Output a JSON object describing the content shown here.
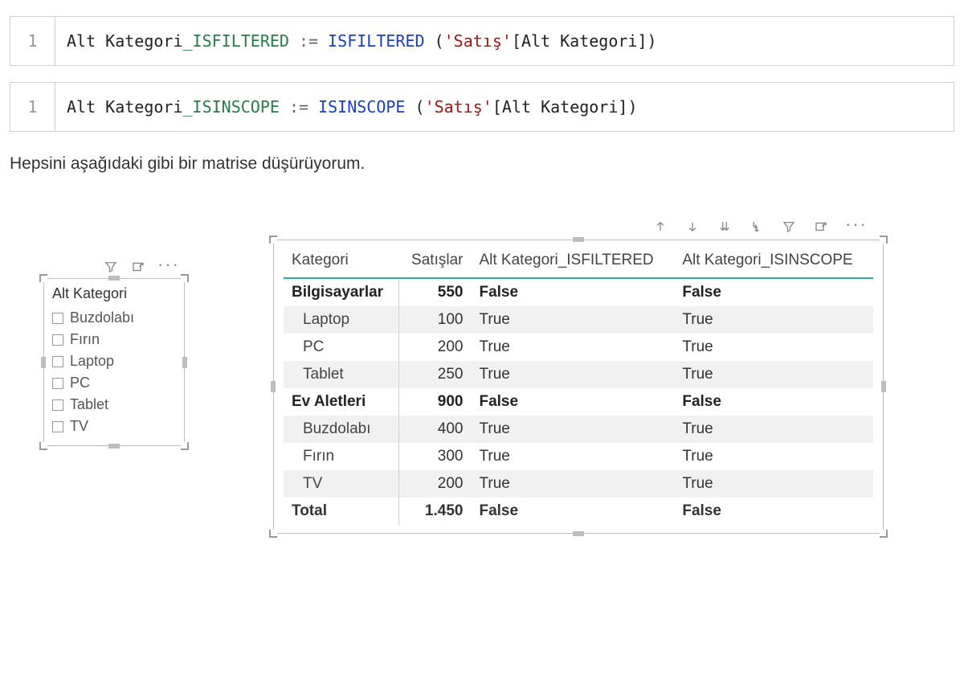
{
  "code_blocks": [
    {
      "line_no": "1",
      "measure_name": "Alt Kategori",
      "suffix": "_ISFILTERED",
      "assign": " := ",
      "func": "ISFILTERED",
      "open": " (",
      "string": "'Satış'",
      "column": "[Alt Kategori]",
      "close": ")"
    },
    {
      "line_no": "1",
      "measure_name": "Alt Kategori",
      "suffix": "_ISINSCOPE",
      "assign": " := ",
      "func": "ISINSCOPE",
      "open": " (",
      "string": "'Satış'",
      "column": "[Alt Kategori]",
      "close": ")"
    }
  ],
  "prose_text": "Hepsini aşağıdaki gibi bir matrise düşürüyorum.",
  "slicer": {
    "title": "Alt Kategori",
    "items": [
      "Buzdolabı",
      "Fırın",
      "Laptop",
      "PC",
      "Tablet",
      "TV"
    ]
  },
  "matrix": {
    "headers": [
      "Kategori",
      "Satışlar",
      "Alt Kategori_ISFILTERED",
      "Alt Kategori_ISINSCOPE"
    ],
    "rows": [
      {
        "level": 0,
        "label": "Bilgisayarlar",
        "sales": "550",
        "isfiltered": "False",
        "isinscope": "False",
        "striped": false
      },
      {
        "level": 1,
        "label": "Laptop",
        "sales": "100",
        "isfiltered": "True",
        "isinscope": "True",
        "striped": true
      },
      {
        "level": 1,
        "label": "PC",
        "sales": "200",
        "isfiltered": "True",
        "isinscope": "True",
        "striped": false
      },
      {
        "level": 1,
        "label": "Tablet",
        "sales": "250",
        "isfiltered": "True",
        "isinscope": "True",
        "striped": true
      },
      {
        "level": 0,
        "label": "Ev Aletleri",
        "sales": "900",
        "isfiltered": "False",
        "isinscope": "False",
        "striped": false
      },
      {
        "level": 1,
        "label": "Buzdolabı",
        "sales": "400",
        "isfiltered": "True",
        "isinscope": "True",
        "striped": true
      },
      {
        "level": 1,
        "label": "Fırın",
        "sales": "300",
        "isfiltered": "True",
        "isinscope": "True",
        "striped": false
      },
      {
        "level": 1,
        "label": "TV",
        "sales": "200",
        "isfiltered": "True",
        "isinscope": "True",
        "striped": true
      }
    ],
    "total": {
      "label": "Total",
      "sales": "1.450",
      "isfiltered": "False",
      "isinscope": "False"
    }
  }
}
